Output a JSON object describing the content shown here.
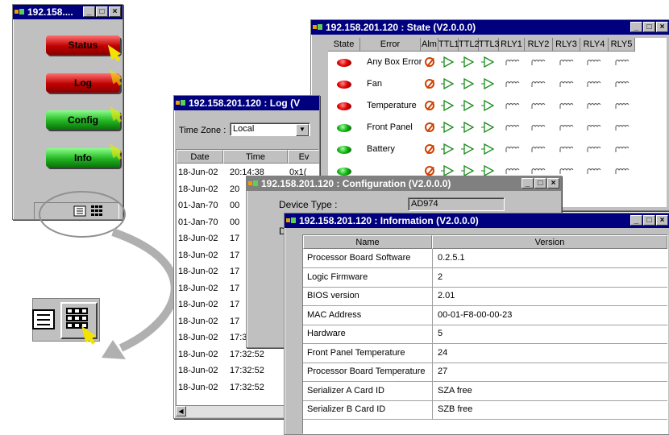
{
  "main_panel": {
    "title": "192.158....",
    "buttons": {
      "status": "Status",
      "log": "Log",
      "config": "Config",
      "info": "Info"
    }
  },
  "state_window": {
    "title": "192.158.201.120 : State (V2.0.0.0)",
    "headers": [
      "State",
      "Error",
      "Alm",
      "TTL1",
      "TTL2",
      "TTL3",
      "RLY1",
      "RLY2",
      "RLY3",
      "RLY4",
      "RLY5"
    ],
    "rows": [
      {
        "led": "red",
        "error": "Any Box Error"
      },
      {
        "led": "red",
        "error": "Fan"
      },
      {
        "led": "red",
        "error": "Temperature"
      },
      {
        "led": "green",
        "error": "Front Panel"
      },
      {
        "led": "green",
        "error": "Battery"
      },
      {
        "led": "green",
        "error": ""
      }
    ]
  },
  "log_window": {
    "title": "192.158.201.120 : Log (V",
    "timezone_label": "Time Zone :",
    "timezone_value": "Local",
    "headers": [
      "Date",
      "Time",
      "Ev"
    ],
    "rows": [
      [
        "18-Jun-02",
        "20:14:38",
        "0x1("
      ],
      [
        "18-Jun-02",
        "20",
        ""
      ],
      [
        "01-Jan-70",
        "00",
        ""
      ],
      [
        "01-Jan-70",
        "00",
        ""
      ],
      [
        "18-Jun-02",
        "17",
        ""
      ],
      [
        "18-Jun-02",
        "17",
        ""
      ],
      [
        "18-Jun-02",
        "17",
        ""
      ],
      [
        "18-Jun-02",
        "17",
        ""
      ],
      [
        "18-Jun-02",
        "17",
        ""
      ],
      [
        "18-Jun-02",
        "17",
        ""
      ],
      [
        "18-Jun-02",
        "17:32:52",
        ""
      ],
      [
        "18-Jun-02",
        "17:32:52",
        ""
      ],
      [
        "18-Jun-02",
        "17:32:52",
        ""
      ],
      [
        "18-Jun-02",
        "17:32:52",
        ""
      ]
    ]
  },
  "config_window": {
    "title": "192.158.201.120 : Configuration (V2.0.0.0)",
    "device_type_label": "Device Type :",
    "device_type_value": "AD974",
    "second_label": "D"
  },
  "info_window": {
    "title": "192.158.201.120 : Information (V2.0.0.0)",
    "headers": [
      "Name",
      "Version"
    ],
    "rows": [
      [
        "Processor Board Software",
        "0.2.5.1"
      ],
      [
        "Logic Firmware",
        "2"
      ],
      [
        "BIOS version",
        "2.01"
      ],
      [
        "MAC Address",
        "00-01-F8-00-00-23"
      ],
      [
        "Hardware",
        "5"
      ],
      [
        "Front Panel Temperature",
        "24"
      ],
      [
        "Processor Board Temperature",
        "27"
      ],
      [
        "Serializer A Card ID",
        "SZA free"
      ],
      [
        "Serializer B Card ID",
        "SZB free"
      ]
    ]
  },
  "colors": {
    "title_active": "#00007f",
    "title_inactive": "#808080",
    "window_face": "#c0c0c0",
    "led_red": "#e00000",
    "led_green": "#12b312",
    "cursor": "#f2e400"
  },
  "icons": [
    "app-icon",
    "minimize-icon",
    "maximize-icon",
    "close-icon",
    "list-view-icon",
    "grid-view-icon",
    "alarm-off-icon",
    "ttl-buffer-icon",
    "relay-icon",
    "pointer-cursor-icon",
    "curved-arrow-icon"
  ]
}
